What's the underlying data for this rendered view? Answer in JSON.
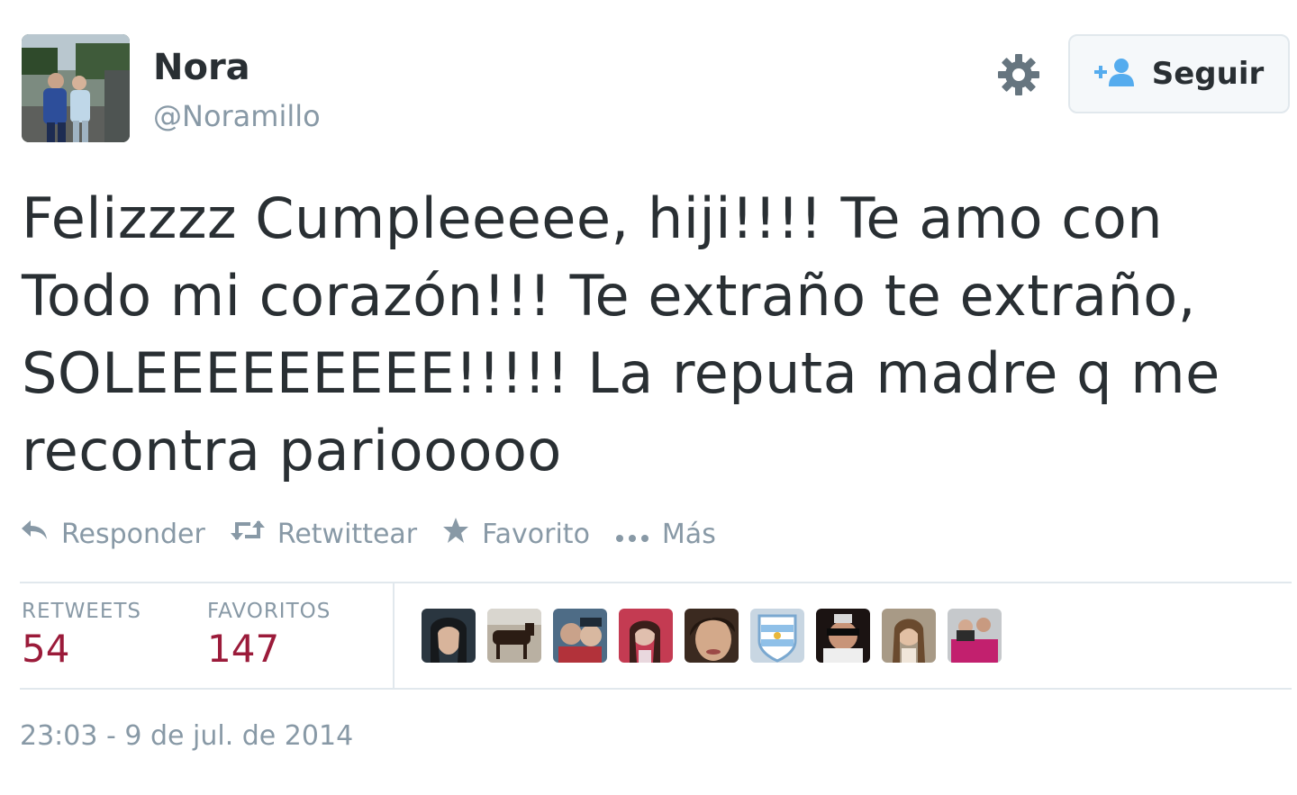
{
  "user": {
    "name": "Nora",
    "handle": "@Noramillo"
  },
  "header": {
    "follow_label": "Seguir"
  },
  "tweet": {
    "lines": [
      "Felizzzz Cumpleeeee, hiji!!!! Te amo con",
      "Todo mi corazón!!! Te extraño te extraño,",
      "SOLEEEEEEEEE!!!!! La reputa madre q me",
      "recontra pariooooo"
    ]
  },
  "actions": {
    "reply": "Responder",
    "retweet": "Retwittear",
    "favorite": "Favorito",
    "more": "Más"
  },
  "stats": {
    "retweets_label": "RETWEETS",
    "retweets_value": "54",
    "favorites_label": "FAVORITOS",
    "favorites_value": "147"
  },
  "timestamp": "23:03 - 9 de jul. de 2014",
  "colors": {
    "text": "#292f33",
    "muted": "#8899a6",
    "stat_value": "#9b1b3a",
    "follow_icon": "#55acee",
    "border": "#e1e8ed"
  }
}
